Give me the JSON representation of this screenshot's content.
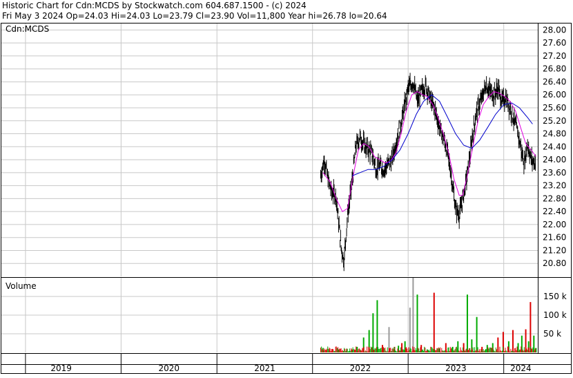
{
  "header": {
    "line1": "Historic Chart for Cdn:MCDS by Stockwatch.com 604.687.1500 - (c) 2024",
    "line2": "Fri May  3 2024   Op=24.03   Hi=24.03   Lo=23.79   Cl=23.90   Vol=11,800   Year hi=26.78   lo=20.64"
  },
  "price_panel": {
    "label": "Cdn:MCDS"
  },
  "volume_panel": {
    "label": "Volume"
  },
  "colors": {
    "background": "#ffffff",
    "grid": "#c8c8c8",
    "frame": "#000000",
    "price_bar": "#000000",
    "ma_short": "#e000e0",
    "ma_long": "#0000cc",
    "volume_up": "#00aa00",
    "volume_down": "#dd0000",
    "volume_flat": "#999999"
  },
  "chart_data": [
    {
      "type": "line",
      "title": "Cdn:MCDS",
      "x_ticks": [
        "2019",
        "2020",
        "2021",
        "2022",
        "2023",
        "2024"
      ],
      "xlim": [
        "2018-10-01",
        "2024-05-10"
      ],
      "ylim": [
        20.4,
        28.2
      ],
      "y_ticks": [
        "20.80",
        "21.20",
        "21.60",
        "22.00",
        "22.40",
        "22.80",
        "23.20",
        "23.60",
        "24.00",
        "24.40",
        "24.80",
        "25.20",
        "25.60",
        "26.00",
        "26.40",
        "26.80",
        "27.20",
        "27.60",
        "28.00"
      ],
      "grid": true,
      "series": [
        {
          "style": "daily-bars",
          "points": [
            [
              "2022-02-01",
              23.5
            ],
            [
              "2022-02-15",
              24.0
            ],
            [
              "2022-03-01",
              23.4
            ],
            [
              "2022-03-15",
              23.0
            ],
            [
              "2022-04-01",
              22.9
            ],
            [
              "2022-04-20",
              21.3
            ],
            [
              "2022-05-01",
              20.9
            ],
            [
              "2022-05-15",
              22.3
            ],
            [
              "2022-06-01",
              23.3
            ],
            [
              "2022-06-15",
              24.4
            ],
            [
              "2022-07-01",
              24.7
            ],
            [
              "2022-07-20",
              24.4
            ],
            [
              "2022-08-05",
              24.3
            ],
            [
              "2022-08-20",
              24.1
            ],
            [
              "2022-09-01",
              23.7
            ],
            [
              "2022-09-15",
              23.8
            ],
            [
              "2022-10-01",
              23.7
            ],
            [
              "2022-10-20",
              23.9
            ],
            [
              "2022-11-01",
              24.0
            ],
            [
              "2022-11-15",
              24.5
            ],
            [
              "2022-12-01",
              25.0
            ],
            [
              "2022-12-15",
              25.5
            ],
            [
              "2023-01-01",
              26.2
            ],
            [
              "2023-01-20",
              26.4
            ],
            [
              "2023-02-05",
              25.8
            ],
            [
              "2023-02-20",
              26.1
            ],
            [
              "2023-03-10",
              26.3
            ],
            [
              "2023-03-25",
              25.9
            ],
            [
              "2023-04-15",
              25.5
            ],
            [
              "2023-05-01",
              25.0
            ],
            [
              "2023-05-15",
              24.7
            ],
            [
              "2023-06-01",
              24.2
            ],
            [
              "2023-06-15",
              23.5
            ],
            [
              "2023-07-01",
              22.5
            ],
            [
              "2023-07-15",
              22.3
            ],
            [
              "2023-08-01",
              22.9
            ],
            [
              "2023-08-20",
              23.8
            ],
            [
              "2023-09-05",
              24.8
            ],
            [
              "2023-09-20",
              25.5
            ],
            [
              "2023-10-10",
              25.9
            ],
            [
              "2023-10-25",
              26.3
            ],
            [
              "2023-11-10",
              26.1
            ],
            [
              "2023-11-25",
              26.0
            ],
            [
              "2023-12-10",
              26.2
            ],
            [
              "2023-12-25",
              25.8
            ],
            [
              "2024-01-10",
              25.9
            ],
            [
              "2024-01-25",
              25.6
            ],
            [
              "2024-02-10",
              25.2
            ],
            [
              "2024-02-25",
              24.8
            ],
            [
              "2024-03-10",
              24.2
            ],
            [
              "2024-03-20",
              23.9
            ],
            [
              "2024-04-01",
              24.5
            ],
            [
              "2024-04-15",
              24.0
            ],
            [
              "2024-05-03",
              23.9
            ]
          ]
        },
        {
          "style": "ma-short",
          "points": [
            [
              "2022-02-10",
              23.6
            ],
            [
              "2022-03-10",
              23.3
            ],
            [
              "2022-04-01",
              22.8
            ],
            [
              "2022-04-25",
              22.4
            ],
            [
              "2022-05-15",
              22.5
            ],
            [
              "2022-06-05",
              23.5
            ],
            [
              "2022-06-25",
              24.3
            ],
            [
              "2022-07-15",
              24.5
            ],
            [
              "2022-08-05",
              24.4
            ],
            [
              "2022-08-25",
              24.1
            ],
            [
              "2022-09-15",
              24.0
            ],
            [
              "2022-10-05",
              23.9
            ],
            [
              "2022-10-25",
              23.95
            ],
            [
              "2022-11-15",
              24.2
            ],
            [
              "2022-12-05",
              24.8
            ],
            [
              "2022-12-25",
              25.5
            ],
            [
              "2023-01-15",
              26.0
            ],
            [
              "2023-02-05",
              26.1
            ],
            [
              "2023-02-25",
              26.0
            ],
            [
              "2023-03-15",
              25.95
            ],
            [
              "2023-04-05",
              25.7
            ],
            [
              "2023-04-25",
              25.3
            ],
            [
              "2023-05-15",
              24.8
            ],
            [
              "2023-06-05",
              24.2
            ],
            [
              "2023-06-25",
              23.4
            ],
            [
              "2023-07-15",
              22.9
            ],
            [
              "2023-07-28",
              22.9
            ],
            [
              "2023-08-15",
              23.5
            ],
            [
              "2023-09-05",
              24.4
            ],
            [
              "2023-09-25",
              25.2
            ],
            [
              "2023-10-15",
              25.7
            ],
            [
              "2023-11-05",
              25.95
            ],
            [
              "2023-11-25",
              26.1
            ],
            [
              "2023-12-15",
              26.05
            ],
            [
              "2024-01-05",
              25.95
            ],
            [
              "2024-01-25",
              25.8
            ],
            [
              "2024-02-15",
              25.5
            ],
            [
              "2024-03-05",
              25.0
            ],
            [
              "2024-03-25",
              24.5
            ],
            [
              "2024-04-15",
              24.3
            ],
            [
              "2024-05-03",
              24.1
            ]
          ]
        },
        {
          "style": "ma-long",
          "points": [
            [
              "2022-06-01",
              23.5
            ],
            [
              "2022-07-01",
              23.6
            ],
            [
              "2022-08-01",
              23.7
            ],
            [
              "2022-09-01",
              23.7
            ],
            [
              "2022-10-01",
              23.8
            ],
            [
              "2022-11-01",
              24.0
            ],
            [
              "2022-12-01",
              24.3
            ],
            [
              "2023-01-01",
              24.8
            ],
            [
              "2023-02-01",
              25.4
            ],
            [
              "2023-03-01",
              25.8
            ],
            [
              "2023-04-01",
              26.0
            ],
            [
              "2023-05-01",
              25.8
            ],
            [
              "2023-06-01",
              25.3
            ],
            [
              "2023-07-01",
              24.8
            ],
            [
              "2023-08-01",
              24.45
            ],
            [
              "2023-09-01",
              24.35
            ],
            [
              "2023-10-01",
              24.6
            ],
            [
              "2023-11-01",
              25.0
            ],
            [
              "2023-12-01",
              25.4
            ],
            [
              "2024-01-01",
              25.7
            ],
            [
              "2024-02-01",
              25.75
            ],
            [
              "2024-03-01",
              25.6
            ],
            [
              "2024-04-01",
              25.3
            ],
            [
              "2024-04-20",
              25.1
            ]
          ]
        }
      ]
    },
    {
      "type": "bar",
      "title": "Volume",
      "ylim": [
        0,
        200000
      ],
      "y_ticks": [
        "50 k",
        "100 k",
        "150 k"
      ],
      "grid": true,
      "series": [
        {
          "style": "volume",
          "points": [
            [
              "2022-02-10",
              12000,
              "up"
            ],
            [
              "2022-03-05",
              5000,
              "down"
            ],
            [
              "2022-04-10",
              8000,
              "up"
            ],
            [
              "2022-05-12",
              10000,
              "up"
            ],
            [
              "2022-06-01",
              8000,
              "down"
            ],
            [
              "2022-06-20",
              15000,
              "up"
            ],
            [
              "2022-07-15",
              40000,
              "up"
            ],
            [
              "2022-08-05",
              60000,
              "up"
            ],
            [
              "2022-08-20",
              105000,
              "up"
            ],
            [
              "2022-09-05",
              140000,
              "up"
            ],
            [
              "2022-09-25",
              20000,
              "down"
            ],
            [
              "2022-10-20",
              68000,
              "flat"
            ],
            [
              "2022-11-10",
              15000,
              "down"
            ],
            [
              "2022-11-25",
              18000,
              "up"
            ],
            [
              "2022-12-08",
              25000,
              "down"
            ],
            [
              "2022-12-20",
              30000,
              "up"
            ],
            [
              "2023-01-08",
              120000,
              "flat"
            ],
            [
              "2023-01-20",
              200000,
              "flat"
            ],
            [
              "2023-02-05",
              155000,
              "up"
            ],
            [
              "2023-02-20",
              20000,
              "down"
            ],
            [
              "2023-03-15",
              8000,
              "up"
            ],
            [
              "2023-04-10",
              160000,
              "down"
            ],
            [
              "2023-05-01",
              10000,
              "up"
            ],
            [
              "2023-05-25",
              25000,
              "down"
            ],
            [
              "2023-06-20",
              15000,
              "up"
            ],
            [
              "2023-07-10",
              30000,
              "up"
            ],
            [
              "2023-08-01",
              25000,
              "down"
            ],
            [
              "2023-08-15",
              155000,
              "up"
            ],
            [
              "2023-09-01",
              35000,
              "up"
            ],
            [
              "2023-09-20",
              95000,
              "up"
            ],
            [
              "2023-10-10",
              15000,
              "down"
            ],
            [
              "2023-10-30",
              20000,
              "up"
            ],
            [
              "2023-11-20",
              25000,
              "up"
            ],
            [
              "2023-12-10",
              40000,
              "down"
            ],
            [
              "2023-12-30",
              55000,
              "down"
            ],
            [
              "2024-01-20",
              30000,
              "up"
            ],
            [
              "2024-02-05",
              60000,
              "down"
            ],
            [
              "2024-02-25",
              25000,
              "up"
            ],
            [
              "2024-03-10",
              45000,
              "up"
            ],
            [
              "2024-03-25",
              62000,
              "down"
            ],
            [
              "2024-04-05",
              30000,
              "up"
            ],
            [
              "2024-04-12",
              135000,
              "down"
            ],
            [
              "2024-04-25",
              45000,
              "up"
            ],
            [
              "2024-05-03",
              12000,
              "up"
            ]
          ]
        }
      ]
    }
  ]
}
